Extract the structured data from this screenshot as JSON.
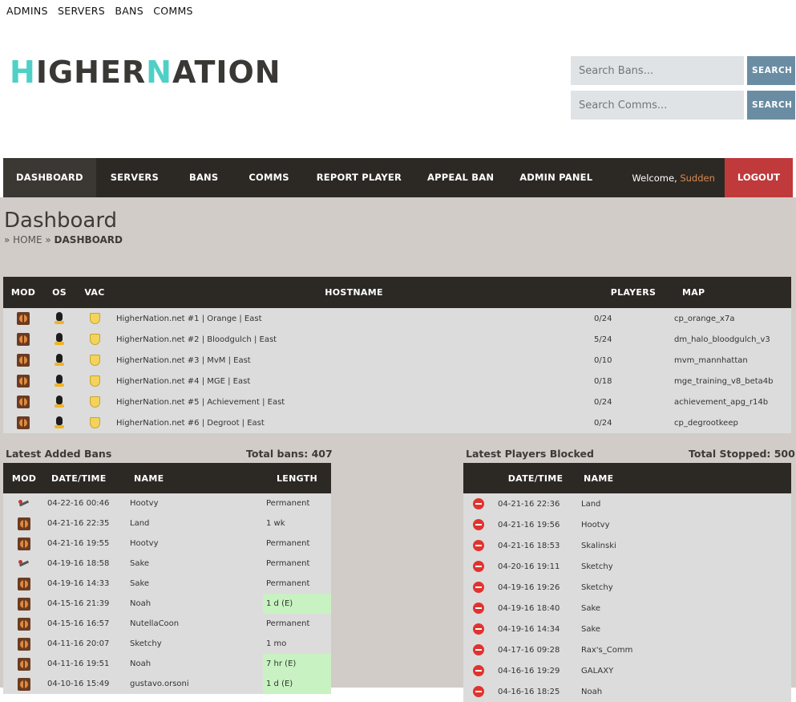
{
  "toplinks": [
    "ADMINS",
    "SERVERS",
    "BANS",
    "COMMS"
  ],
  "logo": {
    "p1": "H",
    "p2": "IGHER",
    "p3": "N",
    "p4": "ATION"
  },
  "search": {
    "bans_placeholder": "Search Bans...",
    "comms_placeholder": "Search Comms...",
    "button_label": "SEARCH"
  },
  "nav": {
    "items": [
      "DASHBOARD",
      "SERVERS",
      "BANS",
      "COMMS",
      "REPORT PLAYER",
      "APPEAL BAN",
      "ADMIN PANEL"
    ],
    "welcome": "Welcome,",
    "user": "Sudden",
    "logout": "LOGOUT"
  },
  "page": {
    "title": "Dashboard",
    "crumb_home": "HOME",
    "crumb_current": "DASHBOARD"
  },
  "servers": {
    "headers": [
      "MOD",
      "OS",
      "VAC",
      "HOSTNAME",
      "PLAYERS",
      "MAP"
    ],
    "rows": [
      {
        "hostname": "HigherNation.net #1 | Orange | East",
        "players": "0/24",
        "map": "cp_orange_x7a"
      },
      {
        "hostname": "HigherNation.net #2 | Bloodgulch | East",
        "players": "5/24",
        "map": "dm_halo_bloodgulch_v3"
      },
      {
        "hostname": "HigherNation.net #3 | MvM | East",
        "players": "0/10",
        "map": "mvm_mannhattan"
      },
      {
        "hostname": "HigherNation.net #4 | MGE | East",
        "players": "0/18",
        "map": "mge_training_v8_beta4b"
      },
      {
        "hostname": "HigherNation.net #5 | Achievement | East",
        "players": "0/24",
        "map": "achievement_apg_r14b"
      },
      {
        "hostname": "HigherNation.net #6 | Degroot | East",
        "players": "0/24",
        "map": "cp_degrootkeep"
      }
    ]
  },
  "bans": {
    "title": "Latest Added Bans",
    "total_label": "Total bans: 407",
    "headers": [
      "MOD",
      "DATE/TIME",
      "NAME",
      "LENGTH"
    ],
    "rows": [
      {
        "icon": "wrench-icon",
        "date": "04-22-16 00:46",
        "name": "Hootvy",
        "length": "Permanent",
        "highlight": false
      },
      {
        "icon": "tf2-icon",
        "date": "04-21-16 22:35",
        "name": "Land",
        "length": "1 wk",
        "highlight": false
      },
      {
        "icon": "tf2-icon",
        "date": "04-21-16 19:55",
        "name": "Hootvy",
        "length": "Permanent",
        "highlight": false
      },
      {
        "icon": "wrench-icon",
        "date": "04-19-16 18:58",
        "name": "Sake",
        "length": "Permanent",
        "highlight": false
      },
      {
        "icon": "tf2-icon",
        "date": "04-19-16 14:33",
        "name": "Sake",
        "length": "Permanent",
        "highlight": false
      },
      {
        "icon": "tf2-icon",
        "date": "04-15-16 21:39",
        "name": "Noah",
        "length": "1 d (E)",
        "highlight": true
      },
      {
        "icon": "tf2-icon",
        "date": "04-15-16 16:57",
        "name": "NutellaCoon",
        "length": "Permanent",
        "highlight": false
      },
      {
        "icon": "tf2-icon",
        "date": "04-11-16 20:07",
        "name": "Sketchy",
        "length": "1 mo",
        "highlight": false
      },
      {
        "icon": "tf2-icon",
        "date": "04-11-16 19:51",
        "name": "Noah",
        "length": "7 hr (E)",
        "highlight": true
      },
      {
        "icon": "tf2-icon",
        "date": "04-10-16 15:49",
        "name": "gustavo.orsoni",
        "length": "1 d (E)",
        "highlight": true
      }
    ]
  },
  "blocked": {
    "title": "Latest Players Blocked",
    "total_label": "Total Stopped: 500",
    "headers": [
      "",
      "DATE/TIME",
      "NAME"
    ],
    "rows": [
      {
        "date": "04-21-16 22:36",
        "name": "Land"
      },
      {
        "date": "04-21-16 19:56",
        "name": "Hootvy"
      },
      {
        "date": "04-21-16 18:53",
        "name": "Skalinski"
      },
      {
        "date": "04-20-16 19:11",
        "name": "Sketchy"
      },
      {
        "date": "04-19-16 19:26",
        "name": "Sketchy"
      },
      {
        "date": "04-19-16 18:40",
        "name": "Sake"
      },
      {
        "date": "04-19-16 14:34",
        "name": "Sake"
      },
      {
        "date": "04-17-16 09:28",
        "name": "Rax's_Comm"
      },
      {
        "date": "04-16-16 19:29",
        "name": "GALAXY"
      },
      {
        "date": "04-16-16 18:25",
        "name": "Noah"
      }
    ]
  }
}
